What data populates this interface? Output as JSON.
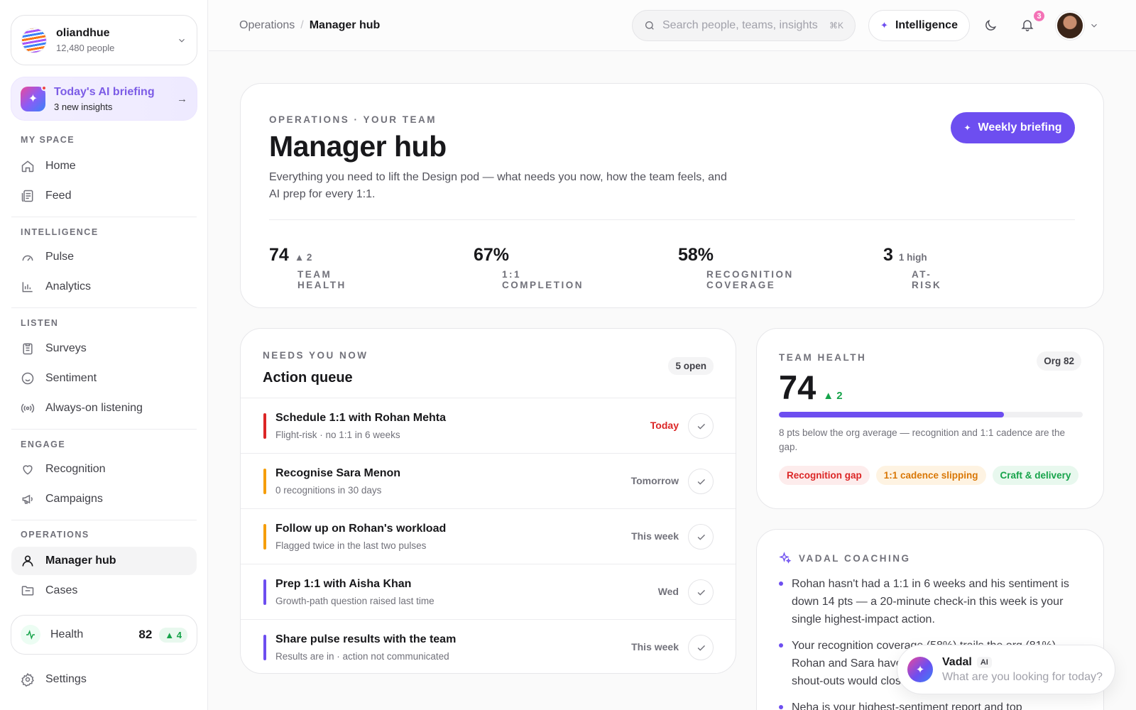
{
  "org": {
    "name": "oliandhue",
    "people": "12,480 people"
  },
  "briefing": {
    "title": "Today's AI briefing",
    "subtitle": "3 new insights"
  },
  "sidebar": {
    "sections": [
      {
        "label": "MY SPACE",
        "items": [
          {
            "label": "Home",
            "icon": "home-icon"
          },
          {
            "label": "Feed",
            "icon": "feed-icon"
          }
        ]
      },
      {
        "label": "INTELLIGENCE",
        "items": [
          {
            "label": "Pulse",
            "icon": "gauge-icon"
          },
          {
            "label": "Analytics",
            "icon": "bar-chart-icon"
          }
        ]
      },
      {
        "label": "LISTEN",
        "items": [
          {
            "label": "Surveys",
            "icon": "clipboard-icon"
          },
          {
            "label": "Sentiment",
            "icon": "smile-icon"
          },
          {
            "label": "Always-on listening",
            "icon": "broadcast-icon"
          }
        ]
      },
      {
        "label": "ENGAGE",
        "items": [
          {
            "label": "Recognition",
            "icon": "heart-hand-icon"
          },
          {
            "label": "Campaigns",
            "icon": "megaphone-icon"
          }
        ]
      },
      {
        "label": "OPERATIONS",
        "items": [
          {
            "label": "Manager hub",
            "icon": "user-icon",
            "active": true
          },
          {
            "label": "Cases",
            "icon": "folder-icon"
          }
        ]
      }
    ],
    "health": {
      "label": "Health",
      "value": "82",
      "delta": "▲ 4"
    },
    "settings": "Settings"
  },
  "topbar": {
    "breadcrumb": [
      "Operations",
      "Manager hub"
    ],
    "search_placeholder": "Search people, teams, insights",
    "search_shortcut": "⌘K",
    "intelligence_label": "Intelligence",
    "notifications_count": "3"
  },
  "hero": {
    "eyebrow": "OPERATIONS · YOUR TEAM",
    "title": "Manager hub",
    "description": "Everything you need to lift the Design pod — what needs you now, how the team feels, and AI prep for every 1:1.",
    "button": "Weekly briefing",
    "stats": [
      {
        "label": "TEAM HEALTH",
        "value": "74",
        "sub": "▲ 2"
      },
      {
        "label": "1:1 COMPLETION",
        "value": "67%",
        "sub": ""
      },
      {
        "label": "RECOGNITION COVERAGE",
        "value": "58%",
        "sub": ""
      },
      {
        "label": "AT-RISK",
        "value": "3",
        "sub": "1 high"
      }
    ]
  },
  "queue": {
    "eyebrow": "NEEDS YOU NOW",
    "title": "Action queue",
    "badge": "5 open",
    "items": [
      {
        "title": "Schedule 1:1 with Rohan Mehta",
        "sub": "Flight-risk · no 1:1 in 6 weeks",
        "when": "Today",
        "color": "#dc2626",
        "when_color": "#dc2626"
      },
      {
        "title": "Recognise Sara Menon",
        "sub": "0 recognitions in 30 days",
        "when": "Tomorrow",
        "color": "#f59e0b",
        "when_color": "#71717a"
      },
      {
        "title": "Follow up on Rohan's workload",
        "sub": "Flagged twice in the last two pulses",
        "when": "This week",
        "color": "#f59e0b",
        "when_color": "#71717a"
      },
      {
        "title": "Prep 1:1 with Aisha Khan",
        "sub": "Growth-path question raised last time",
        "when": "Wed",
        "color": "#6d4ef0",
        "when_color": "#71717a"
      },
      {
        "title": "Share pulse results with the team",
        "sub": "Results are in · action not communicated",
        "when": "This week",
        "color": "#6d4ef0",
        "when_color": "#71717a"
      }
    ]
  },
  "team_health": {
    "eyebrow": "TEAM HEALTH",
    "org_badge": "Org 82",
    "value": "74",
    "delta": "▲ 2",
    "progress": 0.74,
    "note": "8 pts below the org average — recognition and 1:1 cadence are the gap.",
    "tags": [
      {
        "label": "Recognition gap",
        "bg": "#fdecec",
        "fg": "#dc2626"
      },
      {
        "label": "1:1 cadence slipping",
        "bg": "#fef3e2",
        "fg": "#d97706"
      },
      {
        "label": "Craft & delivery",
        "bg": "#e8f8ee",
        "fg": "#16a34a"
      }
    ]
  },
  "coaching": {
    "eyebrow": "VADAL COACHING",
    "items": [
      "Rohan hasn't had a 1:1 in 6 weeks and his sentiment is down 14 pts — a 20-minute check-in this week is your single highest-impact action.",
      "Your recognition coverage (58%) trails the org (81%). Rohan and Sara haven't been recognised lately — a few shout-outs would close the gap.",
      "Neha is your highest-sentiment report and top"
    ]
  },
  "vadal": {
    "name": "Vadal",
    "badge": "AI",
    "placeholder": "What are you looking for today?"
  },
  "colors": {
    "accent": "#6d4ef0",
    "positive": "#16a34a",
    "danger": "#dc2626",
    "warning": "#f59e0b"
  }
}
